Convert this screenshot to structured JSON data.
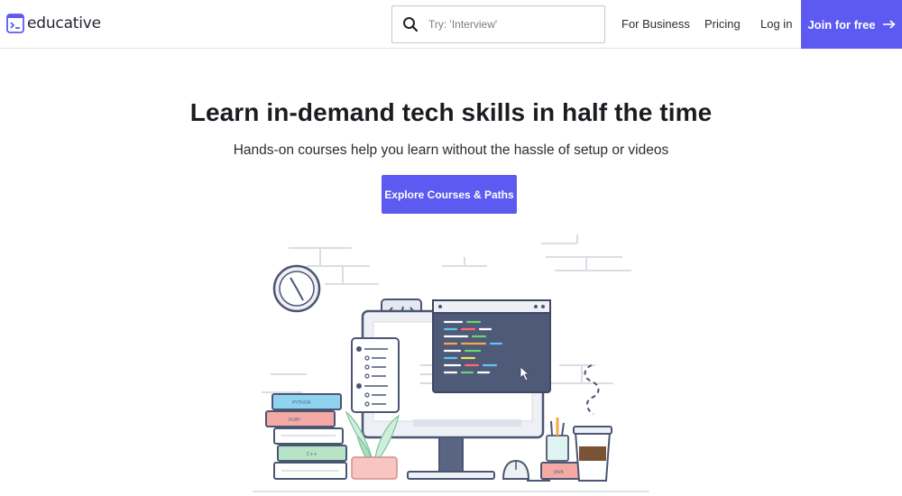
{
  "brand": {
    "name": "educative"
  },
  "search": {
    "placeholder": "Try: 'Interview'"
  },
  "nav": {
    "business": "For Business",
    "pricing": "Pricing",
    "login": "Log in",
    "join": "Join for free"
  },
  "hero": {
    "title": "Learn in-demand tech skills in half the time",
    "subtitle": "Hands-on courses help you learn without the hassle of setup or videos",
    "cta": "Explore Courses & Paths"
  },
  "illustration": {
    "books": [
      "PYTHON",
      "RUBY",
      "C++"
    ],
    "mug_label": "JAVA",
    "icons": [
      "clock-icon",
      "code-icon",
      "monitor-icon",
      "cursor-icon",
      "plant-icon",
      "mouse-icon",
      "coffee-cup-icon"
    ]
  },
  "colors": {
    "accent": "#5c5af0",
    "text": "#1b1b22",
    "code_panel": "#4e5a78"
  }
}
